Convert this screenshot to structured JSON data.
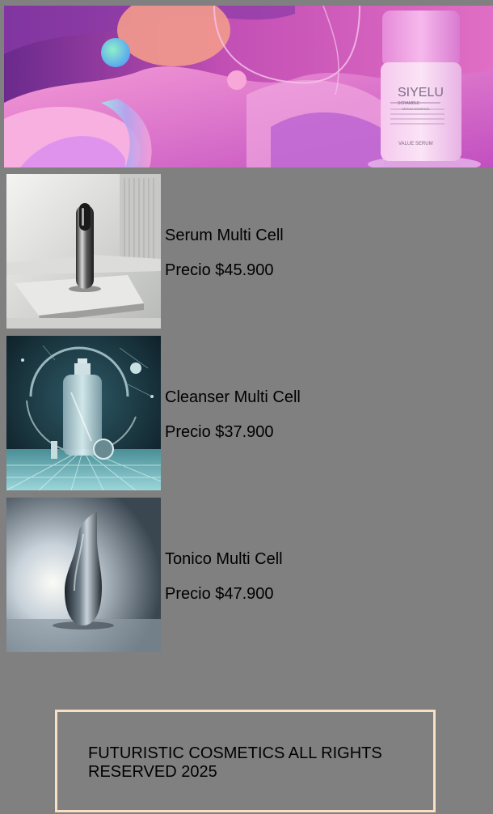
{
  "hero": {
    "product_brand": "SIYELU",
    "product_subtitle": "SCRAMBLE",
    "product_small_1": "SERUM ESSENCE",
    "product_small_2": "VALUE SERUM"
  },
  "products": [
    {
      "name": "Serum Multi Cell",
      "price": "Precio $45.900",
      "image_icon": "serum-bottle-icon"
    },
    {
      "name": "Cleanser Multi Cell",
      "price": "Precio $37.900",
      "image_icon": "cleanser-pump-bottle-icon"
    },
    {
      "name": "Tonico Multi Cell",
      "price": "Precio $47.900",
      "image_icon": "tonic-bottle-icon"
    }
  ],
  "footer": {
    "text": "FUTURISTIC COSMETICS ALL RIGHTS RESERVED 2025"
  },
  "colors": {
    "page_background": "#808080",
    "footer_border": "#f7e0c4",
    "hero_magenta": "#c040b8",
    "hero_pink": "#f070c0"
  }
}
